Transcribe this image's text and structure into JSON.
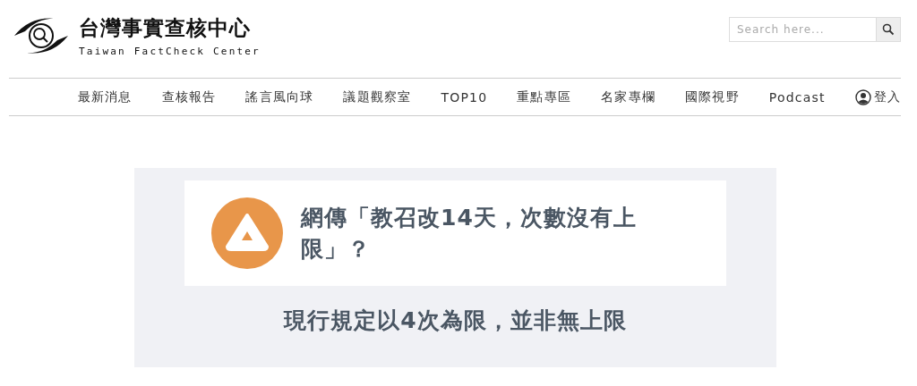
{
  "logo": {
    "title": "台灣事實查核中心",
    "subtitle": "Taiwan FactCheck Center"
  },
  "search": {
    "placeholder": "Search here..."
  },
  "nav": {
    "items": [
      "最新消息",
      "查核報告",
      "謠言風向球",
      "議題觀察室",
      "TOP10",
      "重點專區",
      "名家專欄",
      "國際視野",
      "Podcast"
    ],
    "login": "登入"
  },
  "claim": {
    "title": "網傳「教召改14天，次數沒有上限」？",
    "verdict": "現行規定以4次為限，並非無上限"
  }
}
